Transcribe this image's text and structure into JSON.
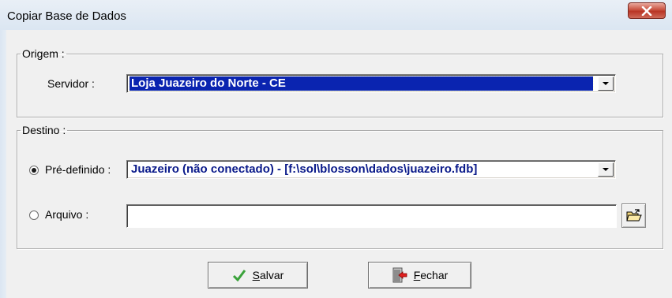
{
  "window": {
    "title": "Copiar Base de Dados",
    "close_icon": "close-icon"
  },
  "origem": {
    "legend": "Origem :",
    "servidor_label": "Servidor :",
    "servidor_value": "Loja Juazeiro do Norte - CE"
  },
  "destino": {
    "legend": "Destino :",
    "predefinido_label": "Pré-definido :",
    "predefinido_value": "Juazeiro (não conectado) - [f:\\sol\\blosson\\dados\\juazeiro.fdb]",
    "predefinido_selected": true,
    "arquivo_label": "Arquivo :",
    "arquivo_value": "",
    "arquivo_selected": false
  },
  "buttons": {
    "salvar_first": "S",
    "salvar_rest": "alvar",
    "fechar_first": "F",
    "fechar_rest": "echar"
  },
  "colors": {
    "selection": "#0a24b0",
    "close_button": "#c8503f",
    "value_text": "#0a1a8a"
  }
}
